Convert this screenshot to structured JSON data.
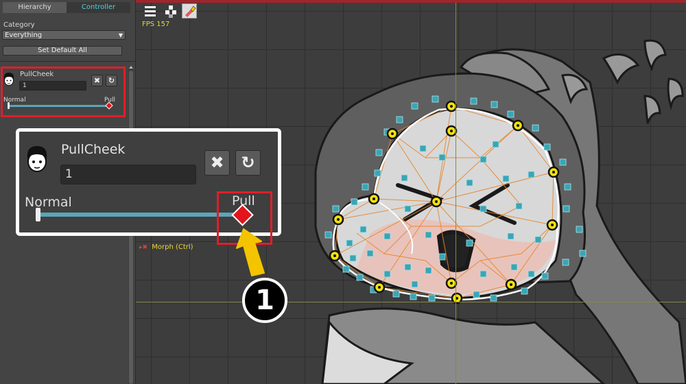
{
  "tabs": {
    "hierarchy": "Hierarchy",
    "controller": "Controller"
  },
  "category": {
    "label": "Category",
    "value": "Everything"
  },
  "set_default_all": "Set Default All",
  "control": {
    "name": "PullCheek",
    "value": "1",
    "min_label": "Normal",
    "max_label": "Pull",
    "slider_value": 1.0
  },
  "viewport": {
    "fps": "FPS 157",
    "morph_label": "Morph (Ctrl)"
  },
  "callout_number": "1",
  "colors": {
    "accent": "#4fd3e0",
    "highlight": "#e01e2a",
    "arrow": "#f5c400",
    "mesh_edge": "#e7842a",
    "vertex": "#f2e20a"
  },
  "icons": [
    "menu-icon",
    "checker-icon",
    "brush-icon",
    "face-icon",
    "delete-x-icon",
    "reset-icon",
    "morph-icon",
    "arrow-up-icon"
  ]
}
